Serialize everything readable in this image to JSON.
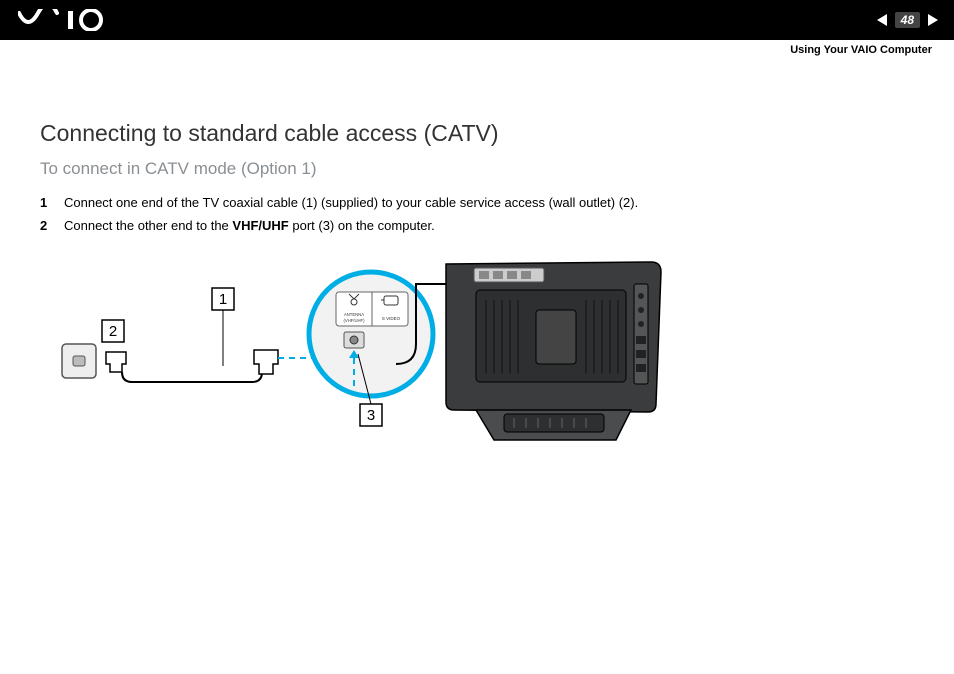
{
  "header": {
    "page_number": "48",
    "section": "Using Your VAIO Computer"
  },
  "content": {
    "title": "Connecting to standard cable access (CATV)",
    "subtitle": "To connect in CATV mode (Option 1)",
    "step1_num": "1",
    "step1_text": "Connect one end of the TV coaxial cable (1) (supplied) to your cable service access (wall outlet) (2).",
    "step2_num": "2",
    "step2_pre": "Connect the other end to the ",
    "step2_bold": "VHF/UHF",
    "step2_post": " port (3) on the computer."
  },
  "figure": {
    "callout_1": "1",
    "callout_2": "2",
    "callout_3": "3",
    "port_label_antenna": "ANTENNA",
    "port_label_vhf": "(VHF/UHF)",
    "port_label_svideo": "S VIDEO"
  }
}
